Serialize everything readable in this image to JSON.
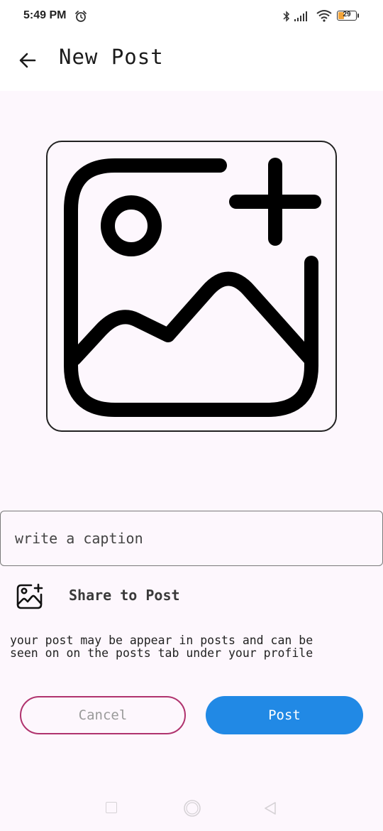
{
  "status_bar": {
    "time": "5:49 PM",
    "battery_level": "29",
    "battery_fraction": 0.29,
    "icons": [
      "alarm-icon",
      "bluetooth-icon",
      "signal-icon",
      "wifi-icon",
      "battery-icon"
    ]
  },
  "app_bar": {
    "title": "New Post",
    "back_icon": "arrow-left-icon"
  },
  "image_picker": {
    "icon": "add-photo-icon"
  },
  "caption": {
    "placeholder": "write a caption",
    "value": ""
  },
  "share": {
    "icon": "add-photo-icon",
    "label": "Share to Post"
  },
  "info": {
    "text": "your post may be appear in posts and can be seen on on the posts tab under your profile"
  },
  "actions": {
    "cancel_label": "Cancel",
    "post_label": "Post"
  },
  "colors": {
    "background": "#fdf7fd",
    "primary": "#2189e5",
    "cancel_border": "#b0336e"
  },
  "nav_bar": {
    "icons": [
      "recents-icon",
      "home-icon",
      "back-icon"
    ]
  }
}
